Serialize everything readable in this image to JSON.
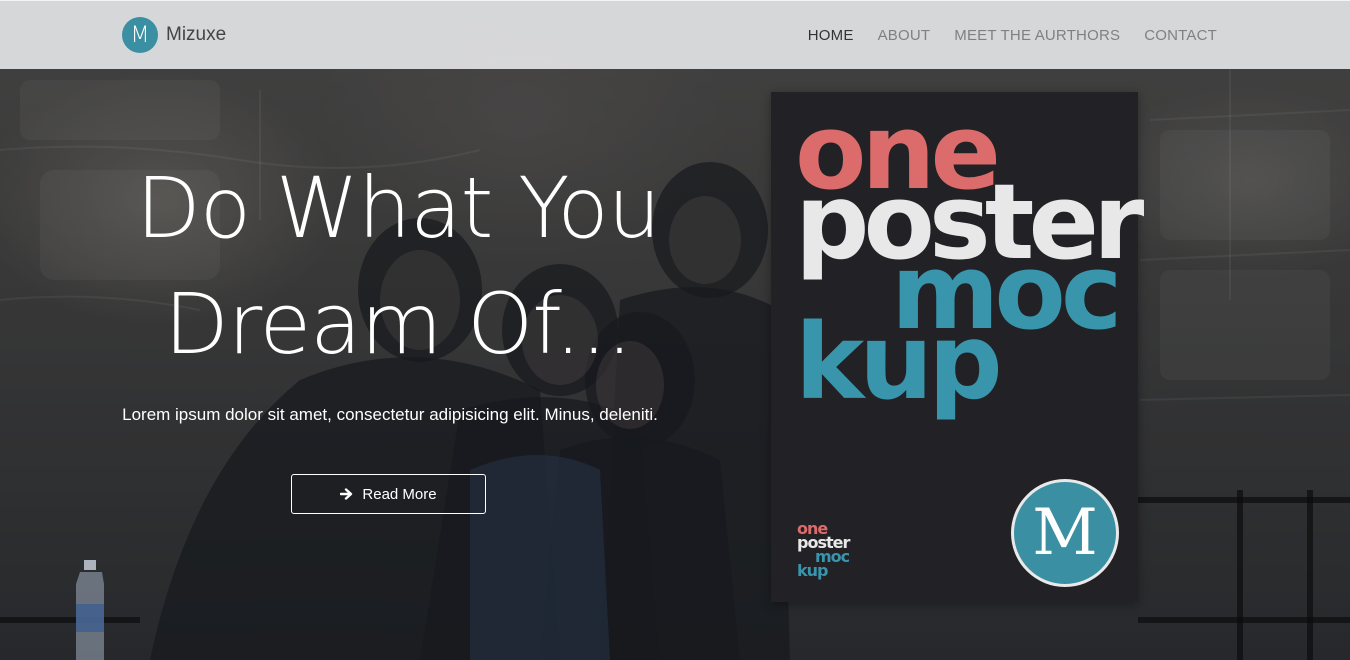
{
  "brand": {
    "logo_letter": "M",
    "name": "Mizuxe"
  },
  "nav": {
    "items": [
      {
        "label": "HOME",
        "active": true
      },
      {
        "label": "ABOUT",
        "active": false
      },
      {
        "label": "MEET THE AURTHORS",
        "active": false
      },
      {
        "label": "CONTACT",
        "active": false
      }
    ]
  },
  "hero": {
    "headline_line1": "Do What You",
    "headline_line2": "Dream Of...",
    "lead": "Lorem ipsum dolor sit amet, consectetur adipisicing elit. Minus, deleniti.",
    "button_label": "Read More",
    "button_icon": "arrow-right-icon"
  },
  "poster": {
    "word1": "one",
    "word2": "poster",
    "word3": "moc",
    "word4": "kup",
    "logo_letter": "M"
  },
  "colors": {
    "accent": "#3a8fa3",
    "poster_pink": "#dc6b6b",
    "poster_teal": "#3895ab",
    "navbar_bg": "#e2e3e5"
  }
}
